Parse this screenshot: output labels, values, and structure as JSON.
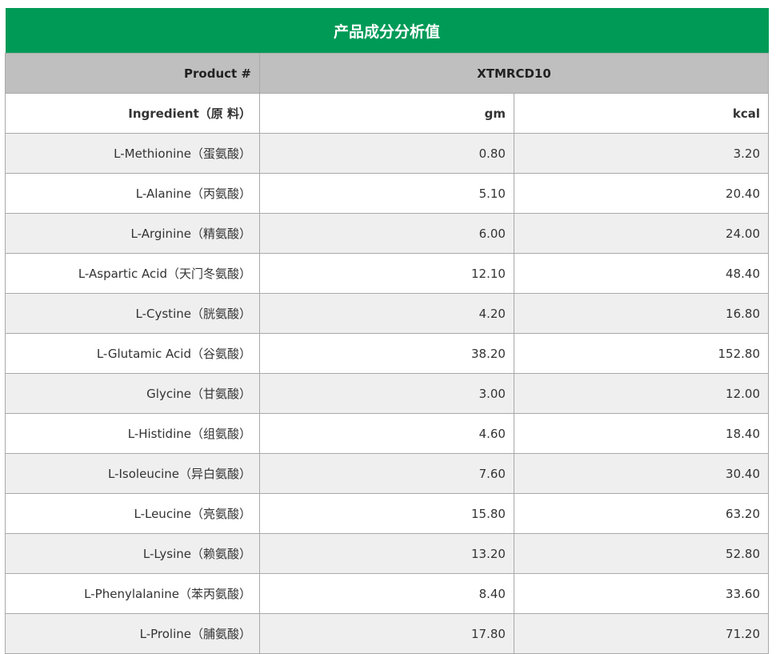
{
  "title": "产品成分分析值",
  "product": {
    "label": "Product #",
    "value": "XTMRCD10"
  },
  "columns": {
    "ingredient": "Ingredient（原 料）",
    "gm": "gm",
    "kcal": "kcal"
  },
  "rows": [
    {
      "ingredient": "L-Methionine（蛋氨酸）",
      "gm": "0.80",
      "kcal": "3.20"
    },
    {
      "ingredient": "L-Alanine（丙氨酸）",
      "gm": "5.10",
      "kcal": "20.40"
    },
    {
      "ingredient": "L-Arginine（精氨酸）",
      "gm": "6.00",
      "kcal": "24.00"
    },
    {
      "ingredient": "L-Aspartic Acid（天门冬氨酸）",
      "gm": "12.10",
      "kcal": "48.40"
    },
    {
      "ingredient": "L-Cystine（胱氨酸）",
      "gm": "4.20",
      "kcal": "16.80"
    },
    {
      "ingredient": "L-Glutamic Acid（谷氨酸）",
      "gm": "38.20",
      "kcal": "152.80"
    },
    {
      "ingredient": "Glycine（甘氨酸）",
      "gm": "3.00",
      "kcal": "12.00"
    },
    {
      "ingredient": "L-Histidine（组氨酸）",
      "gm": "4.60",
      "kcal": "18.40"
    },
    {
      "ingredient": "L-Isoleucine（异白氨酸）",
      "gm": "7.60",
      "kcal": "30.40"
    },
    {
      "ingredient": "L-Leucine（亮氨酸）",
      "gm": "15.80",
      "kcal": "63.20"
    },
    {
      "ingredient": "L-Lysine（赖氨酸）",
      "gm": "13.20",
      "kcal": "52.80"
    },
    {
      "ingredient": "L-Phenylalanine（苯丙氨酸）",
      "gm": "8.40",
      "kcal": "33.60"
    },
    {
      "ingredient": "L-Proline（脯氨酸）",
      "gm": "17.80",
      "kcal": "71.20"
    }
  ],
  "colors": {
    "title_bg": "#009a57",
    "product_row_bg": "#bfbfbf",
    "stripe_bg": "#efefef"
  }
}
